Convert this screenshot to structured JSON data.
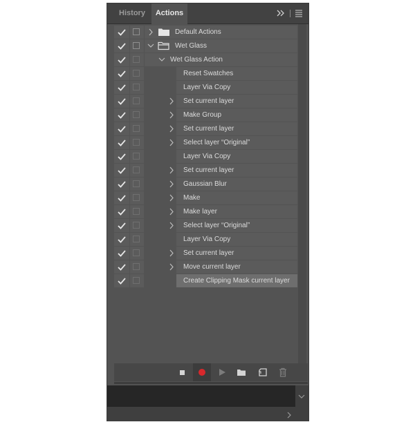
{
  "tabs": [
    {
      "label": "History",
      "active": false
    },
    {
      "label": "Actions",
      "active": true
    }
  ],
  "header_icons": [
    "collapse-panels-icon",
    "panel-menu-icon"
  ],
  "actions": [
    {
      "label": "Default Actions",
      "kind": "set",
      "level": 0,
      "expander": "collapsed",
      "checked": true,
      "selected": false
    },
    {
      "label": "Wet Glass",
      "kind": "set",
      "level": 0,
      "expander": "expanded",
      "checked": true,
      "selected": false
    },
    {
      "label": "Wet Glass Action",
      "kind": "action",
      "level": 1,
      "expander": "expanded",
      "checked": true,
      "selected": false
    },
    {
      "label": "Reset Swatches",
      "kind": "step",
      "level": 2,
      "expander": "none",
      "checked": true,
      "selected": false
    },
    {
      "label": "Layer Via Copy",
      "kind": "step",
      "level": 2,
      "expander": "none",
      "checked": true,
      "selected": false
    },
    {
      "label": "Set current layer",
      "kind": "step",
      "level": 2,
      "expander": "collapsed",
      "checked": true,
      "selected": false
    },
    {
      "label": "Make Group",
      "kind": "step",
      "level": 2,
      "expander": "collapsed",
      "checked": true,
      "selected": false
    },
    {
      "label": "Set current layer",
      "kind": "step",
      "level": 2,
      "expander": "collapsed",
      "checked": true,
      "selected": false
    },
    {
      "label": "Select layer “Original”",
      "kind": "step",
      "level": 2,
      "expander": "collapsed",
      "checked": true,
      "selected": false
    },
    {
      "label": "Layer Via Copy",
      "kind": "step",
      "level": 2,
      "expander": "none",
      "checked": true,
      "selected": false
    },
    {
      "label": "Set current layer",
      "kind": "step",
      "level": 2,
      "expander": "collapsed",
      "checked": true,
      "selected": false
    },
    {
      "label": "Gaussian Blur",
      "kind": "step",
      "level": 2,
      "expander": "collapsed",
      "checked": true,
      "selected": false
    },
    {
      "label": "Make",
      "kind": "step",
      "level": 2,
      "expander": "collapsed",
      "checked": true,
      "selected": false
    },
    {
      "label": "Make layer",
      "kind": "step",
      "level": 2,
      "expander": "collapsed",
      "checked": true,
      "selected": false
    },
    {
      "label": "Select layer “Original”",
      "kind": "step",
      "level": 2,
      "expander": "collapsed",
      "checked": true,
      "selected": false
    },
    {
      "label": "Layer Via Copy",
      "kind": "step",
      "level": 2,
      "expander": "none",
      "checked": true,
      "selected": false
    },
    {
      "label": "Set current layer",
      "kind": "step",
      "level": 2,
      "expander": "collapsed",
      "checked": true,
      "selected": false
    },
    {
      "label": "Move current layer",
      "kind": "step",
      "level": 2,
      "expander": "collapsed",
      "checked": true,
      "selected": false
    },
    {
      "label": "Create Clipping Mask current layer",
      "kind": "step",
      "level": 2,
      "expander": "none",
      "checked": true,
      "selected": true
    }
  ],
  "toolbar": [
    {
      "name": "stop-button",
      "icon": "stop-icon"
    },
    {
      "name": "record-button",
      "icon": "record-icon",
      "active": true
    },
    {
      "name": "play-button",
      "icon": "play-icon"
    },
    {
      "name": "new-set-button",
      "icon": "folder-icon"
    },
    {
      "name": "new-action-button",
      "icon": "new-item-icon"
    },
    {
      "name": "delete-button",
      "icon": "trash-icon"
    }
  ],
  "colors": {
    "panel_bg": "#535353",
    "row_bg": "#5b5b5b",
    "selected_row_bg": "#6e6e6e",
    "record": "#d8282c",
    "text": "#dcdcdc"
  }
}
